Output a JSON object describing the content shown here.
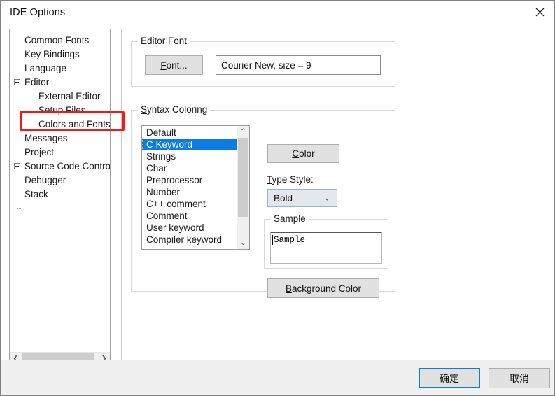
{
  "window": {
    "title": "IDE Options",
    "close_icon": "close-icon"
  },
  "tree": {
    "items": [
      {
        "label": "Common Fonts",
        "level": 1,
        "expander": "none"
      },
      {
        "label": "Key Bindings",
        "level": 1,
        "expander": "none"
      },
      {
        "label": "Language",
        "level": 1,
        "expander": "none"
      },
      {
        "label": "Editor",
        "level": 1,
        "expander": "minus"
      },
      {
        "label": "External Editor",
        "level": 2,
        "expander": "none"
      },
      {
        "label": "Setup Files",
        "level": 2,
        "expander": "none"
      },
      {
        "label": "Colors and Fonts",
        "level": 2,
        "expander": "none",
        "highlighted": true
      },
      {
        "label": "Messages",
        "level": 1,
        "expander": "none"
      },
      {
        "label": "Project",
        "level": 1,
        "expander": "plus"
      },
      {
        "label": "Source Code Contro",
        "level": 1,
        "expander": "none"
      },
      {
        "label": "Debugger",
        "level": 1,
        "expander": "none"
      },
      {
        "label": "Stack",
        "level": 1,
        "expander": "none"
      }
    ],
    "scrollbar": {
      "left_arrow": "❮",
      "right_arrow": "❯"
    }
  },
  "editor_font": {
    "group_title": "Editor Font",
    "font_button": "Font...",
    "font_button_accel": "F",
    "font_value": "Courier New, size = 9"
  },
  "syntax_coloring": {
    "group_title": "Syntax Coloring",
    "group_title_accel": "S",
    "list_items": [
      "Default",
      "C Keyword",
      "Strings",
      "Char",
      "Preprocessor",
      "Number",
      "C++ comment",
      "Comment",
      "User keyword",
      "Compiler keyword"
    ],
    "selected_item": "C Keyword",
    "selected_index": 1,
    "scroll_up_arrow": "⌃",
    "scroll_down_arrow": "⌄",
    "color_button": "Color",
    "color_button_accel": "C",
    "type_style_label": "Type Style:",
    "type_style_label_accel": "T",
    "type_style_value": "Bold",
    "type_style_options": [
      "Bold"
    ],
    "combo_arrow": "⌄",
    "sample_group_title": "Sample",
    "sample_text": "Sample",
    "background_color_button": "Background Color",
    "background_color_accel": "B"
  },
  "footer": {
    "ok_label": "确定",
    "cancel_label": "取消"
  },
  "colors": {
    "selection_blue": "#0a7ee0",
    "annotation_red": "#f41a13",
    "button_face": "#e1e1e1",
    "footer_bg": "#f0f0f0"
  }
}
